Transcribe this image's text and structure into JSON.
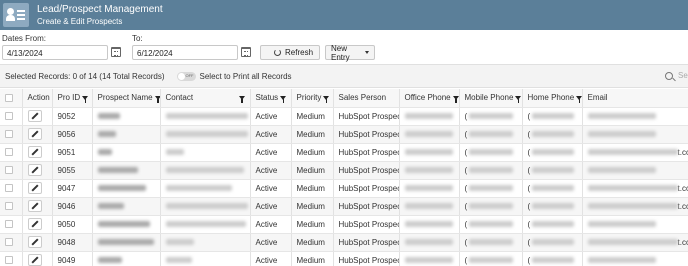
{
  "header": {
    "title": "Lead/Prospect Management",
    "subtitle": "Create & Edit Prospects"
  },
  "filters": {
    "from_label": "Dates From:",
    "to_label": "To:",
    "from_value": "4/13/2024",
    "to_value": "6/12/2024",
    "refresh_label": "Refresh",
    "new_entry_label": "New Entry"
  },
  "toolbar": {
    "selected_text": "Selected Records: 0 of 14 (14 Total Records)",
    "toggle_state": "OFF",
    "toggle_label": "Select to Print all Records",
    "search_placeholder": "Se"
  },
  "columns": [
    "",
    "Action",
    "Pro ID",
    "Prospect Name",
    "Contact",
    "Status",
    "Priority",
    "Sales Person",
    "Office Phone",
    "Mobile Phone",
    "Home Phone",
    "Email"
  ],
  "rows": [
    {
      "pro_id": "9052",
      "status": "Active",
      "priority": "Medium",
      "sales_person": "HubSpot Prospect",
      "mobile_prefix": "(",
      "home_prefix": "(",
      "email_tail": ""
    },
    {
      "pro_id": "9056",
      "status": "Active",
      "priority": "Medium",
      "sales_person": "HubSpot Prospect",
      "mobile_prefix": "(",
      "home_prefix": "(",
      "email_tail": ""
    },
    {
      "pro_id": "9051",
      "status": "Active",
      "priority": "Medium",
      "sales_person": "HubSpot Prospect",
      "mobile_prefix": "(",
      "home_prefix": "(",
      "email_tail": "t.com"
    },
    {
      "pro_id": "9055",
      "status": "Active",
      "priority": "Medium",
      "sales_person": "HubSpot Prospect",
      "mobile_prefix": "(",
      "home_prefix": "(",
      "email_tail": ""
    },
    {
      "pro_id": "9047",
      "status": "Active",
      "priority": "Medium",
      "sales_person": "HubSpot Prospect",
      "mobile_prefix": "(",
      "home_prefix": "(",
      "email_tail": "t.com"
    },
    {
      "pro_id": "9046",
      "status": "Active",
      "priority": "Medium",
      "sales_person": "HubSpot Prospect",
      "mobile_prefix": "(",
      "home_prefix": "(",
      "email_tail": "t.com"
    },
    {
      "pro_id": "9050",
      "status": "Active",
      "priority": "Medium",
      "sales_person": "HubSpot Prospect",
      "mobile_prefix": "(",
      "home_prefix": "(",
      "email_tail": ""
    },
    {
      "pro_id": "9048",
      "status": "Active",
      "priority": "Medium",
      "sales_person": "HubSpot Prospect",
      "mobile_prefix": "(",
      "home_prefix": "(",
      "email_tail": "t.com"
    },
    {
      "pro_id": "9049",
      "status": "Active",
      "priority": "Medium",
      "sales_person": "HubSpot Prospect",
      "mobile_prefix": "(",
      "home_prefix": "(",
      "email_tail": ""
    }
  ]
}
